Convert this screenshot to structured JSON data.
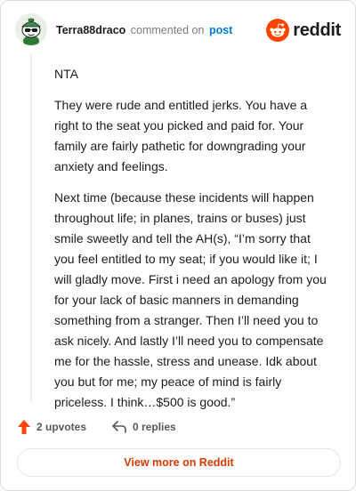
{
  "header": {
    "username": "Terra88draco",
    "action": "commented on",
    "target": "post",
    "brand": "reddit"
  },
  "comment": {
    "paragraphs": [
      "NTA",
      "They were rude and entitled jerks. You have a right to the seat you picked and paid for. Your family are fairly pathetic for downgrading your anxiety and feelings.",
      "Next time (because these incidents will happen throughout life; in planes, trains or buses) just smile sweetly and tell the AH(s), “I’m sorry that you feel entitled to my seat; if you would like it; I will gladly move. First i need an apology from you for your lack of basic manners in demanding something from a stranger. Then I’ll need you to ask nicely. And lastly I’ll need you to compensate me for the hassle, stress and unease. Idk about you but for me; my peace of mind is fairly priceless. I think…$500 is good.”"
    ]
  },
  "actions": {
    "upvotes_label": "2 upvotes",
    "replies_label": "0 replies"
  },
  "footer": {
    "view_more_label": "View more on Reddit"
  },
  "colors": {
    "brand_orange": "#ff4500",
    "upvote_orange": "#ff4500",
    "link_blue": "#0079d3",
    "cta_red": "#d93a00"
  },
  "icons": {
    "avatar": "snoo-avatar-icon",
    "brand": "reddit-logo-icon",
    "upvote": "upvote-arrow-icon",
    "reply": "reply-arrow-icon"
  }
}
